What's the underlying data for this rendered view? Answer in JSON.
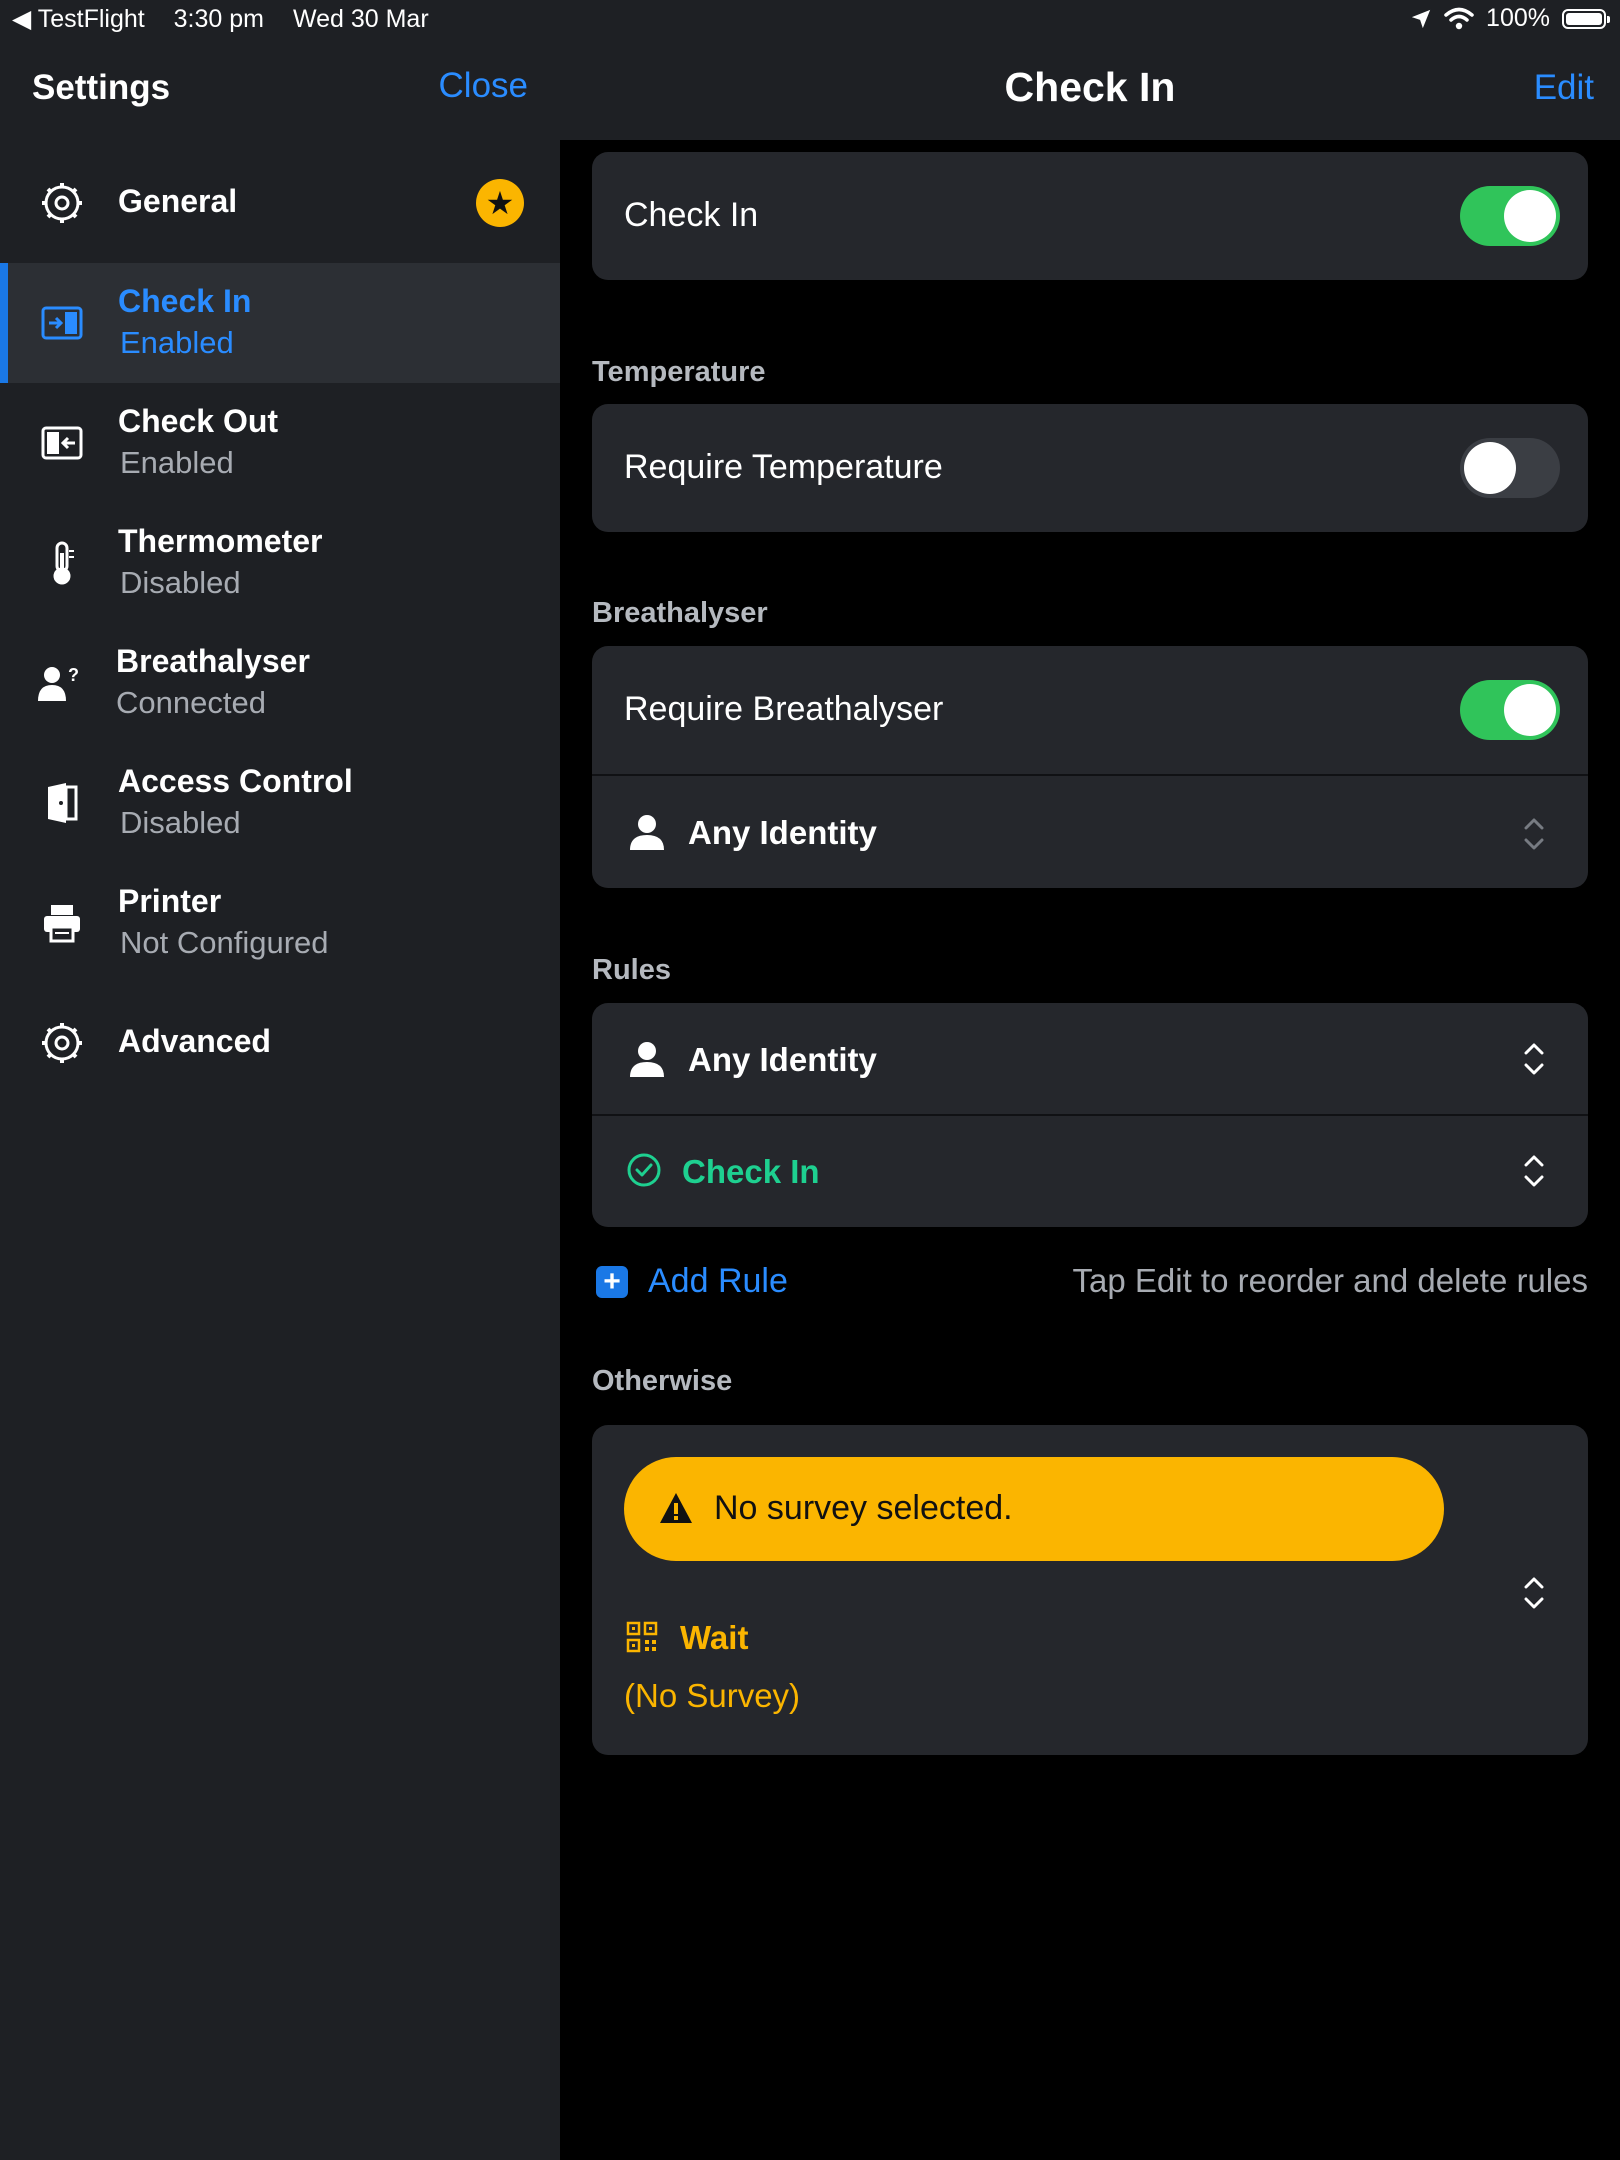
{
  "status_bar": {
    "back_app": "◀ TestFlight",
    "time": "3:30 pm",
    "date": "Wed 30 Mar",
    "battery": "100%"
  },
  "sidebar": {
    "title": "Settings",
    "close_label": "Close",
    "items": [
      {
        "title": "General",
        "subtitle": "",
        "icon": "gear-icon"
      },
      {
        "title": "Check In",
        "subtitle": "Enabled",
        "icon": "check-in-icon"
      },
      {
        "title": "Check Out",
        "subtitle": "Enabled",
        "icon": "check-out-icon"
      },
      {
        "title": "Thermometer",
        "subtitle": "Disabled",
        "icon": "thermometer-icon"
      },
      {
        "title": "Breathalyser",
        "subtitle": "Connected",
        "icon": "person-question-icon"
      },
      {
        "title": "Access Control",
        "subtitle": "Disabled",
        "icon": "door-icon"
      },
      {
        "title": "Printer",
        "subtitle": "Not Configured",
        "icon": "printer-icon"
      },
      {
        "title": "Advanced",
        "subtitle": "",
        "icon": "gear-icon"
      }
    ],
    "active_index": 1
  },
  "detail": {
    "title": "Check In",
    "edit_label": "Edit",
    "check_in_label": "Check In",
    "check_in_enabled": true,
    "temperature_section": "Temperature",
    "require_temperature_label": "Require Temperature",
    "require_temperature_enabled": false,
    "breathalyser_section": "Breathalyser",
    "require_breathalyser_label": "Require Breathalyser",
    "require_breathalyser_enabled": true,
    "breathalyser_identity": "Any Identity",
    "rules_section": "Rules",
    "rule_identity": "Any Identity",
    "rule_action": "Check In",
    "add_rule_label": "Add Rule",
    "rules_hint": "Tap Edit to reorder and delete rules",
    "otherwise_section": "Otherwise",
    "warning_text": "No survey selected.",
    "otherwise_action": "Wait",
    "otherwise_survey": "(No Survey)"
  },
  "colors": {
    "accent": "#2a8cff",
    "toggle_on": "#30c45a",
    "warning": "#fbb500",
    "success": "#1ed090"
  }
}
